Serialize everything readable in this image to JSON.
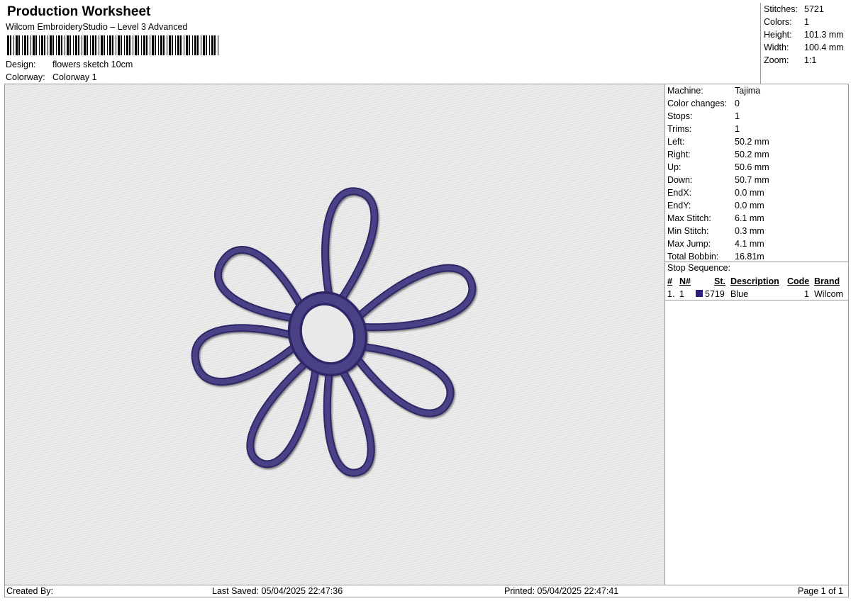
{
  "header": {
    "title": "Production Worksheet",
    "subtitle": "Wilcom EmbroideryStudio – Level 3 Advanced",
    "design_label": "Design:",
    "design_value": "flowers sketch 10cm",
    "colorway_label": "Colorway:",
    "colorway_value": "Colorway 1"
  },
  "stats": [
    {
      "label": "Stitches:",
      "value": "5721"
    },
    {
      "label": "Colors:",
      "value": "1"
    },
    {
      "label": "Height:",
      "value": "101.3 mm"
    },
    {
      "label": "Width:",
      "value": "100.4 mm"
    },
    {
      "label": "Zoom:",
      "value": "1:1"
    }
  ],
  "machine_info": [
    {
      "label": "Machine:",
      "value": "Tajima"
    },
    {
      "label": "Color changes:",
      "value": "0"
    },
    {
      "label": "Stops:",
      "value": "1"
    },
    {
      "label": "Trims:",
      "value": "1"
    },
    {
      "label": "Left:",
      "value": "50.2 mm"
    },
    {
      "label": "Right:",
      "value": "50.2 mm"
    },
    {
      "label": "Up:",
      "value": "50.6 mm"
    },
    {
      "label": "Down:",
      "value": "50.7 mm"
    },
    {
      "label": "EndX:",
      "value": "0.0 mm"
    },
    {
      "label": "EndY:",
      "value": "0.0 mm"
    },
    {
      "label": "Max Stitch:",
      "value": "6.1 mm"
    },
    {
      "label": "Min Stitch:",
      "value": "0.3 mm"
    },
    {
      "label": "Max Jump:",
      "value": "4.1 mm"
    },
    {
      "label": "Total Bobbin:",
      "value": "16.81m"
    }
  ],
  "stop_sequence": {
    "heading": "Stop Sequence:",
    "columns": {
      "num": "#",
      "needle": "N#",
      "stitch": "St.",
      "description": "Description",
      "code": "Code",
      "brand": "Brand"
    },
    "rows": [
      {
        "num": "1.",
        "needle": "1",
        "stitch": "5719",
        "description": "Blue",
        "code": "1",
        "brand": "Wilcom",
        "color": "#2a1f7a"
      }
    ]
  },
  "footer": {
    "created_by": "Created By:",
    "last_saved": "Last Saved: 05/04/2025 22:47:36",
    "printed": "Printed: 05/04/2025 22:47:41",
    "page": "Page 1 of 1"
  },
  "colors": {
    "thread": "#4a4386",
    "thread_dark": "#2e2766",
    "fabric": "#e9e9e9"
  }
}
